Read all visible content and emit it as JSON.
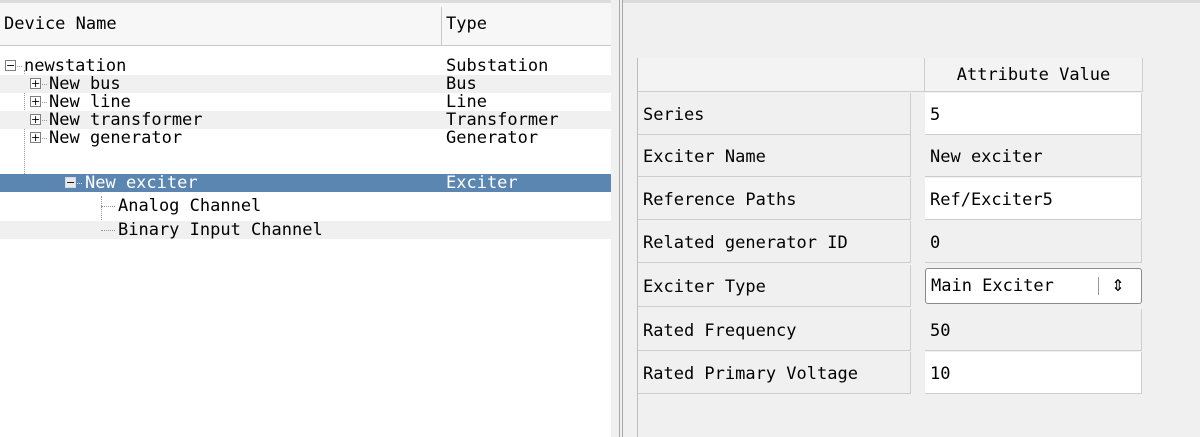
{
  "tree": {
    "columns": {
      "name": "Device Name",
      "type": "Type"
    },
    "rows": [
      {
        "name": "newstation",
        "type": "Substation",
        "expander": "−"
      },
      {
        "name": "New bus",
        "type": "Bus",
        "expander": "+"
      },
      {
        "name": "New line",
        "type": "Line",
        "expander": "+"
      },
      {
        "name": "New transformer",
        "type": "Transformer",
        "expander": "+"
      },
      {
        "name": "New generator",
        "type": "Generator",
        "expander": "+"
      },
      {
        "name": "New exciter",
        "type": "Exciter",
        "expander": "−"
      },
      {
        "name": "Analog Channel",
        "type": ""
      },
      {
        "name": "Binary Input Channel",
        "type": ""
      }
    ]
  },
  "attributes": {
    "column_header": "Attribute Value",
    "rows": [
      {
        "label": "Series",
        "value": "5"
      },
      {
        "label": "Exciter Name",
        "value": "New exciter"
      },
      {
        "label": "Reference Paths",
        "value": "Ref/Exciter5"
      },
      {
        "label": "Related generator ID",
        "value": "0"
      },
      {
        "label": "Exciter Type",
        "value": "Main Exciter",
        "combo_arrow": "⇕"
      },
      {
        "label": "Rated Frequency",
        "value": "50"
      },
      {
        "label": "Rated Primary Voltage",
        "value": "10"
      }
    ]
  },
  "colors": {
    "selection": "#5b86b2",
    "alt_row": "#f0f0f0",
    "panel_bg": "#f0f0f0"
  }
}
